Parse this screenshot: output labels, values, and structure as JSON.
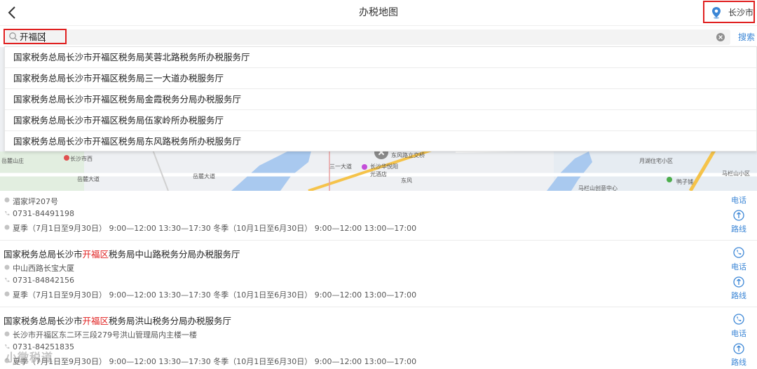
{
  "header": {
    "title": "办税地图",
    "city": "长沙市"
  },
  "search": {
    "value": "开福区",
    "button": "搜索"
  },
  "suggestions": [
    "国家税务总局长沙市开福区税务局芙蓉北路税务所办税服务厅",
    "国家税务总局长沙市开福区税务局三一大道办税服务厅",
    "国家税务总局长沙市开福区税务局金霞税务分局办税服务厅",
    "国家税务总局长沙市开福区税务局伍家岭所办税服务厅",
    "国家税务总局长沙市开福区税务局东风路税务所办税服务厅"
  ],
  "map": {
    "labels": {
      "hospital": "长沙市西",
      "mountain": "岳麓山庄",
      "road1": "岳麓大道",
      "road2": "岳麓大道",
      "sanyi": "三一大道",
      "hotel": "长沙华悦阳光酒店",
      "east": "东风路立交桥",
      "dongfeng": "东风",
      "lake": "月湖住宅小区",
      "park": "马栏山小区",
      "duck": "鸭子铺",
      "mlshan": "马栏山创意中心"
    }
  },
  "actions": {
    "phone": "电话",
    "route": "路线"
  },
  "list": [
    {
      "address": "湄家坪207号",
      "phone": "0731-84491198",
      "hours": "夏季（7月1日至9月30日） 9:00—12:00 13:30—17:30 冬季（10月1日至6月30日） 9:00—12:00 13:00—17:00"
    },
    {
      "title_pre": "国家税务总局长沙市",
      "title_hl": "开福区",
      "title_post": "税务局中山路税务分局办税服务厅",
      "address": "中山西路长宝大厦",
      "phone": "0731-84842156",
      "hours": "夏季（7月1日至9月30日） 9:00—12:00 13:30—17:30 冬季（10月1日至6月30日） 9:00—12:00 13:00—17:00"
    },
    {
      "title_pre": "国家税务总局长沙市",
      "title_hl": "开福区",
      "title_post": "税务局洪山税务分局办税服务厅",
      "address": "长沙市开福区东二环三段279号洪山管理局内主楼一楼",
      "phone": "0731-84251835",
      "hours": "夏季（7月1日至9月30日） 9:00—12:00 13:30—17:30 冬季（10月1日至6月30日） 9:00—12:00 13:00—17:00"
    }
  ],
  "watermark": "小微税道",
  "colors": {
    "accent": "#3b86d6",
    "highlight": "#e02020"
  }
}
